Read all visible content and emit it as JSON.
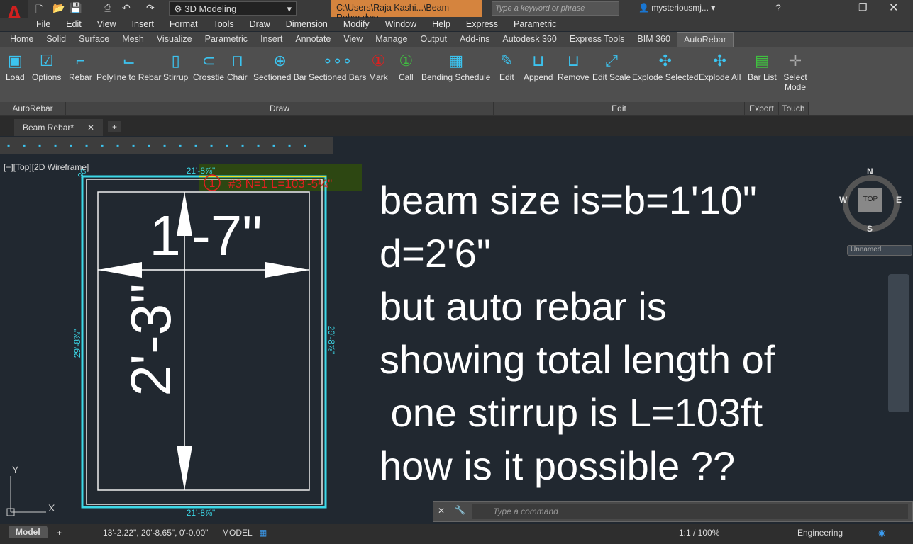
{
  "app": {
    "workspace": "3D Modeling",
    "document_title": "C:\\Users\\Raja Kashi...\\Beam Rebar.dwg",
    "search_placeholder": "Type a keyword or phrase",
    "user": "mysteriousmj...",
    "logo_letter": "A"
  },
  "menu": [
    "File",
    "Edit",
    "View",
    "Insert",
    "Format",
    "Tools",
    "Draw",
    "Dimension",
    "Modify",
    "Window",
    "Help",
    "Express",
    "Parametric"
  ],
  "ribbon_tabs": [
    "Home",
    "Solid",
    "Surface",
    "Mesh",
    "Visualize",
    "Parametric",
    "Insert",
    "Annotate",
    "View",
    "Manage",
    "Output",
    "Add-ins",
    "Autodesk 360",
    "Express Tools",
    "BIM 360",
    "AutoRebar"
  ],
  "active_tab": "AutoRebar",
  "panels": {
    "autorebar": {
      "label": "AutoRebar",
      "tools": [
        "Load",
        "Options"
      ]
    },
    "draw": {
      "label": "Draw",
      "tools": [
        "Rebar",
        "Polyline to Rebar",
        "Stirrup",
        "Crosstie",
        "Chair",
        "Sectioned Bar",
        "Sectioned Bars",
        "Mark",
        "Call",
        "Bending Schedule"
      ]
    },
    "edit": {
      "label": "Edit",
      "tools": [
        "Edit",
        "Append",
        "Remove",
        "Edit Scale",
        "Explode Selected",
        "Explode All"
      ]
    },
    "export": {
      "label": "Export",
      "tools": [
        "Bar List"
      ]
    },
    "touch": {
      "label": "Touch",
      "tools": [
        "Select Mode"
      ]
    }
  },
  "file_tab": "Beam Rebar*",
  "viewport": {
    "label": "[−][Top][2D Wireframe]"
  },
  "drawing": {
    "dim_top": "21'-8⅞\"",
    "dim_bottom": "21'-8⅞\"",
    "dim_left": "29'-8⅞\"",
    "dim_right": "29'-8⅞\"",
    "corner": "90",
    "rebar_label": "#3  N=1  L=103'-5¼\"",
    "mark": "1",
    "width_text": "1'-7\"",
    "height_text": "2'-3\""
  },
  "note": [
    "beam size is=b=1'10\"",
    "d=2'6\"",
    "but auto rebar is",
    "showing total length of",
    " one stirrup is L=103ft",
    "how is it possible ??"
  ],
  "compass": {
    "n": "N",
    "s": "S",
    "e": "E",
    "w": "W",
    "top": "TOP",
    "ucs": "Unnamed"
  },
  "command": {
    "placeholder": "Type  a  command"
  },
  "status": {
    "model_tab": "Model",
    "coords": "13'-2.22\", 20'-8.65\", 0'-0.00\"",
    "space": "MODEL",
    "scale": "1:1 / 100%",
    "units": "Engineering"
  },
  "ucs": {
    "x": "X",
    "y": "Y"
  },
  "colors": {
    "accent": "#d5843e",
    "cyan": "#3cd8e8",
    "rebar": "#e02020",
    "canvas": "#212830"
  }
}
